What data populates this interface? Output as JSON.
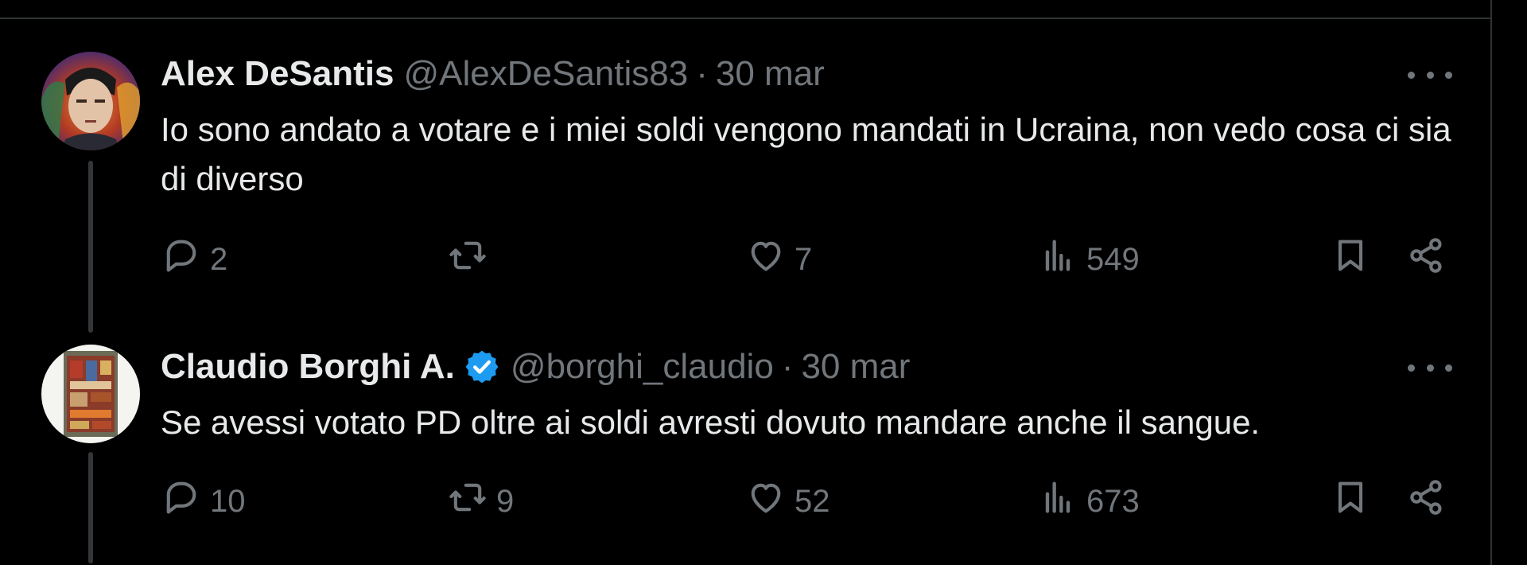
{
  "tweets": [
    {
      "name": "Alex DeSantis",
      "verified": false,
      "handle": "@AlexDeSantis83",
      "separator": "·",
      "time": "30 mar",
      "text": "Io sono andato a votare e i miei soldi vengono mandati in Ucraina, non vedo cosa ci sia di diverso",
      "replies": "2",
      "reposts": "",
      "likes": "7",
      "views": "549"
    },
    {
      "name": "Claudio Borghi A.",
      "verified": true,
      "handle": "@borghi_claudio",
      "separator": "·",
      "time": "30 mar",
      "text": "Se avessi votato PD oltre ai soldi avresti dovuto mandare anche il sangue.",
      "replies": "10",
      "reposts": "9",
      "likes": "52",
      "views": "673"
    }
  ],
  "icons": {
    "reply": "reply-icon",
    "repost": "repost-icon",
    "like": "heart-icon",
    "views": "views-chart-icon",
    "bookmark": "bookmark-icon",
    "share": "share-icon",
    "more": "more-options-icon",
    "verified": "verified-badge-icon"
  },
  "colors": {
    "background": "#000000",
    "text": "#e7e9ea",
    "muted": "#71767b",
    "verified": "#1d9bf0",
    "divider": "#2f3336"
  }
}
